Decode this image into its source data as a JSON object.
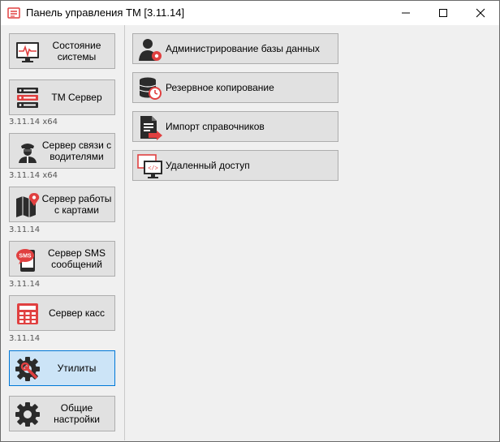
{
  "window": {
    "title": "Панель управления ТМ [3.11.14]"
  },
  "sidebar": {
    "items": [
      {
        "label": "Состояние системы",
        "icon": "monitor-pulse-icon",
        "version": ""
      },
      {
        "label": "ТМ Сервер",
        "icon": "server-icon",
        "version": "3.11.14 x64"
      },
      {
        "label": "Сервер связи с водителями",
        "icon": "driver-icon",
        "version": "3.11.14 x64"
      },
      {
        "label": "Сервер работы с картами",
        "icon": "map-pin-icon",
        "version": "3.11.14"
      },
      {
        "label": "Сервер SMS сообщений",
        "icon": "sms-icon",
        "version": "3.11.14"
      },
      {
        "label": "Сервер касс",
        "icon": "cash-register-icon",
        "version": "3.11.14"
      },
      {
        "label": "Утилиты",
        "icon": "tools-gear-icon",
        "version": "",
        "active": true
      },
      {
        "label": "Общие настройки",
        "icon": "gear-icon",
        "version": ""
      }
    ]
  },
  "utilities": {
    "items": [
      {
        "label": "Администрирование базы данных",
        "icon": "user-admin-icon"
      },
      {
        "label": "Резервное копирование",
        "icon": "database-backup-icon"
      },
      {
        "label": "Импорт справочников",
        "icon": "document-import-icon"
      },
      {
        "label": "Удаленный доступ",
        "icon": "remote-access-icon"
      }
    ]
  },
  "colors": {
    "accent_red": "#e04040",
    "dark_icon": "#2b2b2b",
    "active_bg": "#cce4f7",
    "active_border": "#0078d7"
  }
}
